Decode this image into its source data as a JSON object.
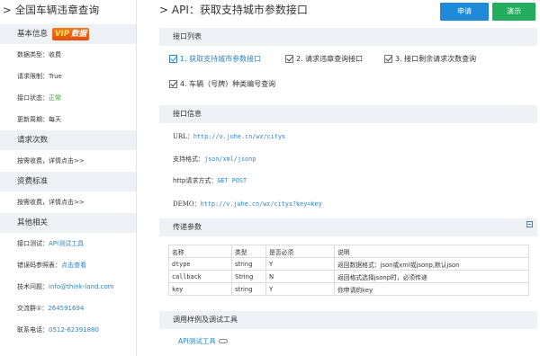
{
  "sidebar": {
    "title": "> 全国车辆违章查询",
    "sections": [
      {
        "heading": "基本信息",
        "badge": "VIP数据",
        "rows": [
          {
            "label": "数据类型：",
            "value": "收费",
            "style": ""
          },
          {
            "label": "请求限制：",
            "value": "True",
            "style": ""
          },
          {
            "label": "接口状态：",
            "value": "正常",
            "style": "green"
          },
          {
            "label": "更新周期：",
            "value": "每天",
            "style": ""
          }
        ]
      },
      {
        "heading": "请求次数",
        "rows": [
          {
            "label": "按需收费，详情点击>>",
            "value": "",
            "style": ""
          }
        ]
      },
      {
        "heading": "资费标准",
        "rows": [
          {
            "label": "按需收费，详情点击>>",
            "value": "",
            "style": ""
          }
        ]
      },
      {
        "heading": "其他相关",
        "rows": [
          {
            "label": "接口测试：",
            "value": "API测试工具",
            "style": "blue"
          },
          {
            "label": "错误码参照表：",
            "value": "点击查看",
            "style": "blue"
          },
          {
            "label": "技术问题：",
            "value": "info@think-land.com",
            "style": "blue"
          },
          {
            "label": "交流群①：",
            "value": "264591694",
            "style": "blue"
          },
          {
            "label": "联系电话：",
            "value": "0512-62391880",
            "style": "blue"
          }
        ]
      }
    ]
  },
  "header": {
    "title": "> API：获取支持城市参数接口",
    "apply_label": "申请",
    "demo_label": "演示"
  },
  "colors": {
    "accent": "#1f8ad8",
    "demo": "#24ad5c",
    "link": "#2a86c8",
    "panel": "#eef2f7",
    "ok": "#3aa935"
  },
  "api_list": {
    "heading": "接口列表",
    "items": [
      {
        "label": "1. 获取支持城市参数接口",
        "active": true
      },
      {
        "label": "2. 请求违章查询接口",
        "active": false
      },
      {
        "label": "3. 接口剩余请求次数查询",
        "active": false
      },
      {
        "label": "4. 车辆（号牌）种类编号查询",
        "active": false
      }
    ]
  },
  "api_info": {
    "heading": "接口信息",
    "url_label": "URL：",
    "url": "http://v.juhe.cn/wz/citys",
    "format_label": "支持格式：",
    "format": "json/xml/jsonp",
    "method_label": "http请求方式：",
    "method": "GET POST",
    "demo_label": "DEMO：",
    "demo": "http://v.juhe.cn/wz/citys?key=key"
  },
  "params": {
    "heading": "传递参数",
    "columns": [
      "名称",
      "类型",
      "是否必须",
      "说明"
    ],
    "rows": [
      [
        "dtype",
        "string",
        "Y",
        "返回数据格式：json或xml或jsonp,默认json"
      ],
      [
        "callback",
        "String",
        "N",
        "返回格式选择jsonp时，必须传递"
      ],
      [
        "key",
        "string",
        "Y",
        "你申请的key"
      ]
    ]
  },
  "tools": {
    "heading": "调用样例及调试工具",
    "link_label": "API测试工具"
  }
}
